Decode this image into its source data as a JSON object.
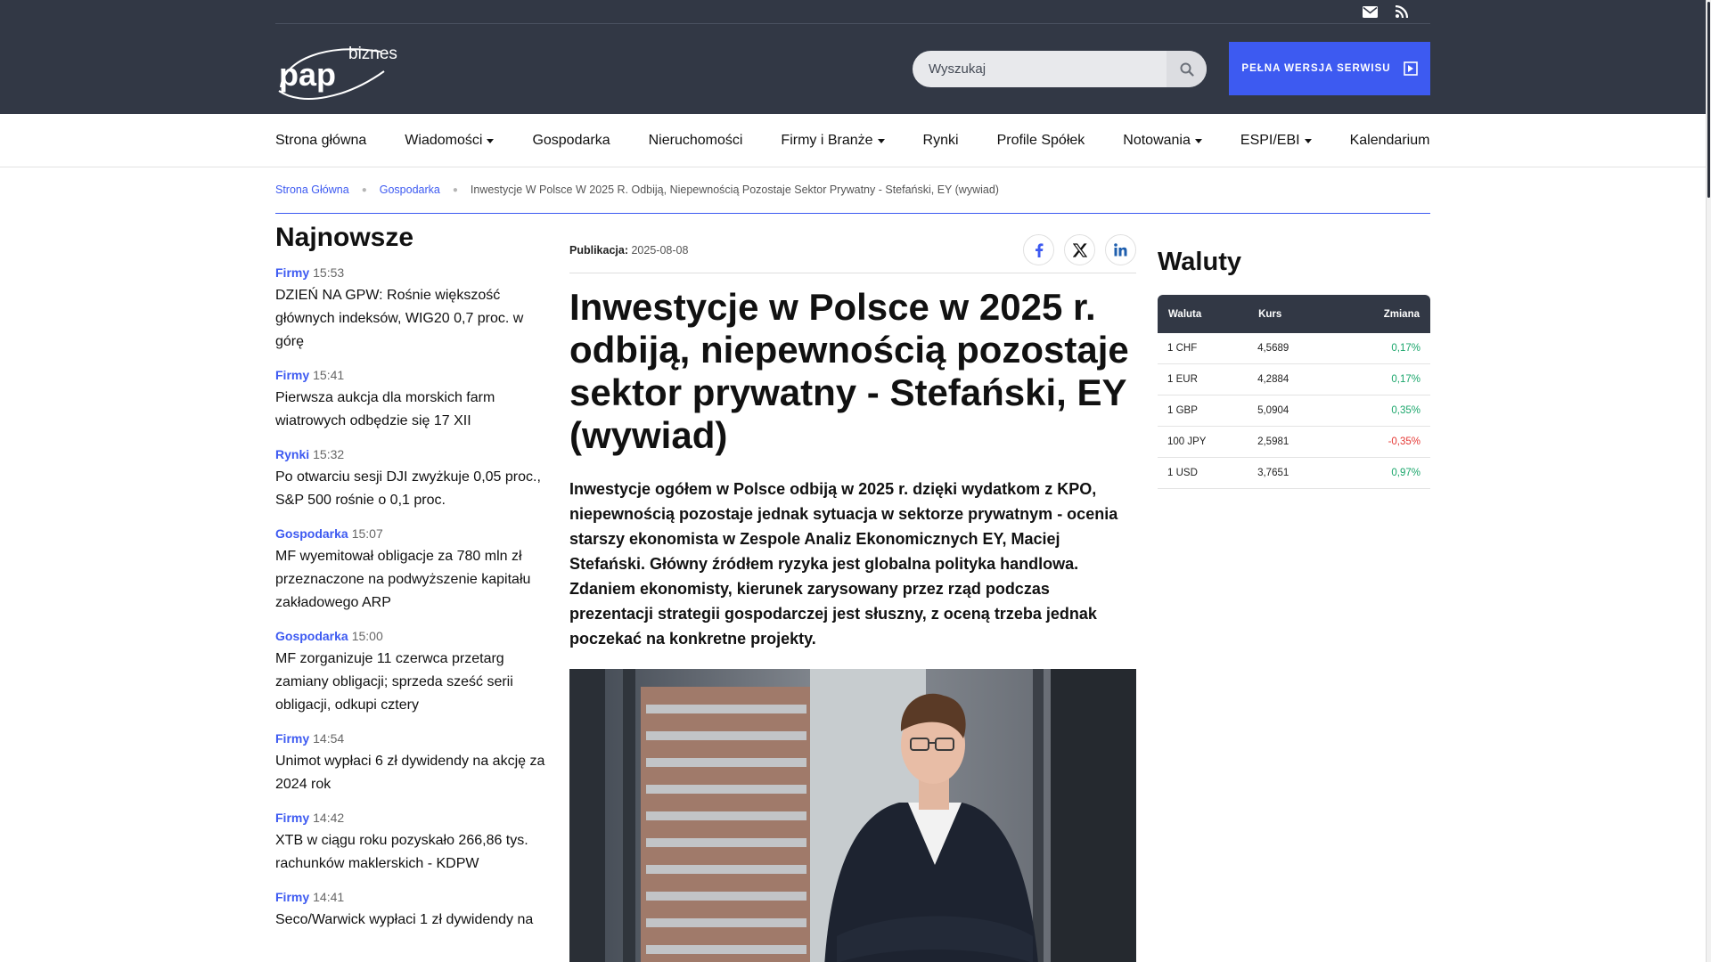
{
  "header": {
    "logo_text_top": "biznes",
    "logo_text_main": "pap",
    "search_placeholder": "Wyszukaj",
    "full_version_label": "PEŁNA WERSJA SERWISU",
    "icons": [
      "mail-icon",
      "rss-icon",
      "search-icon",
      "exit-icon"
    ]
  },
  "nav": {
    "items": [
      {
        "label": "Strona główna",
        "dropdown": false
      },
      {
        "label": "Wiadomości",
        "dropdown": true
      },
      {
        "label": "Gospodarka",
        "dropdown": false
      },
      {
        "label": "Nieruchomości",
        "dropdown": false
      },
      {
        "label": "Firmy i Branże",
        "dropdown": true
      },
      {
        "label": "Rynki",
        "dropdown": false
      },
      {
        "label": "Profile Spółek",
        "dropdown": false
      },
      {
        "label": "Notowania",
        "dropdown": true
      },
      {
        "label": "ESPI/EBI",
        "dropdown": true
      },
      {
        "label": "Kalendarium",
        "dropdown": false
      }
    ]
  },
  "breadcrumb": {
    "home": "Strona Główna",
    "section": "Gospodarka",
    "current": "Inwestycje W Polsce W 2025 R. Odbiją, Niepewnością Pozostaje Sektor Prywatny - Stefański, EY (wywiad)"
  },
  "latest": {
    "heading": "Najnowsze",
    "items": [
      {
        "category": "Firmy",
        "time": "15:53",
        "title": "DZIEŃ NA GPW: Rośnie większość głównych indeksów, WIG20 0,7 proc. w górę"
      },
      {
        "category": "Firmy",
        "time": "15:41",
        "title": "Pierwsza aukcja dla morskich farm wiatrowych odbędzie się 17 XII"
      },
      {
        "category": "Rynki",
        "time": "15:32",
        "title": "Po otwarciu sesji DJI zwyżkuje 0,05 proc., S&P 500 rośnie o 0,1 proc."
      },
      {
        "category": "Gospodarka",
        "time": "15:07",
        "title": "MF wyemitował obligacje za 780 mln zł przeznaczone na podwyższenie kapitału zakładowego ARP"
      },
      {
        "category": "Gospodarka",
        "time": "15:00",
        "title": "MF zorganizuje 11 czerwca przetarg zamiany obligacji; sprzeda sześć serii obligacji, odkupi cztery"
      },
      {
        "category": "Firmy",
        "time": "14:54",
        "title": "Unimot wypłaci 6 zł dywidendy na akcję za 2024 rok"
      },
      {
        "category": "Firmy",
        "time": "14:42",
        "title": "XTB w ciągu roku pozyskało 266,86 tys. rachunków maklerskich - KDPW"
      },
      {
        "category": "Firmy",
        "time": "14:41",
        "title": "Seco/Warwick wypłaci 1 zł dywidendy na"
      }
    ]
  },
  "article": {
    "pub_label": "Publikacja:",
    "pub_date": "2025-08-08",
    "title": "Inwestycje w Polsce w 2025 r. odbiją, niepewnością pozostaje sektor prywatny - Stefański, EY (wywiad)",
    "lead": "Inwestycje ogółem w Polsce odbiją w 2025 r. dzięki wydatkom z KPO, niepewnością pozostaje jednak sytuacja w sektorze prywatnym - ocenia starszy ekonomista w Zespole Analiz Ekonomicznych EY, Maciej Stefański. Główny źródłem ryzyka jest globalna polityka handlowa. Zdaniem ekonomisty, kierunek zarysowany przez rząd podczas prezentacji strategii gospodarczej jest słuszny, z oceną trzeba jednak poczekać na konkretne projekty.",
    "share_icons": [
      "facebook-icon",
      "x-icon",
      "linkedin-icon"
    ]
  },
  "currencies": {
    "heading": "Waluty",
    "columns": [
      "Waluta",
      "Kurs",
      "Zmiana"
    ],
    "rows": [
      {
        "name": "1 CHF",
        "rate": "4,5689",
        "change": "0,17%",
        "dir": "up"
      },
      {
        "name": "1 EUR",
        "rate": "4,2884",
        "change": "0,17%",
        "dir": "up"
      },
      {
        "name": "1 GBP",
        "rate": "5,0904",
        "change": "0,35%",
        "dir": "up"
      },
      {
        "name": "100 JPY",
        "rate": "2,5981",
        "change": "-0,35%",
        "dir": "down"
      },
      {
        "name": "1 USD",
        "rate": "3,7651",
        "change": "0,97%",
        "dir": "up"
      }
    ],
    "colors": {
      "up": "#1aa66b",
      "down": "#e53935"
    }
  },
  "colors": {
    "header_bg": "#323845",
    "accent": "#3d5af1"
  }
}
